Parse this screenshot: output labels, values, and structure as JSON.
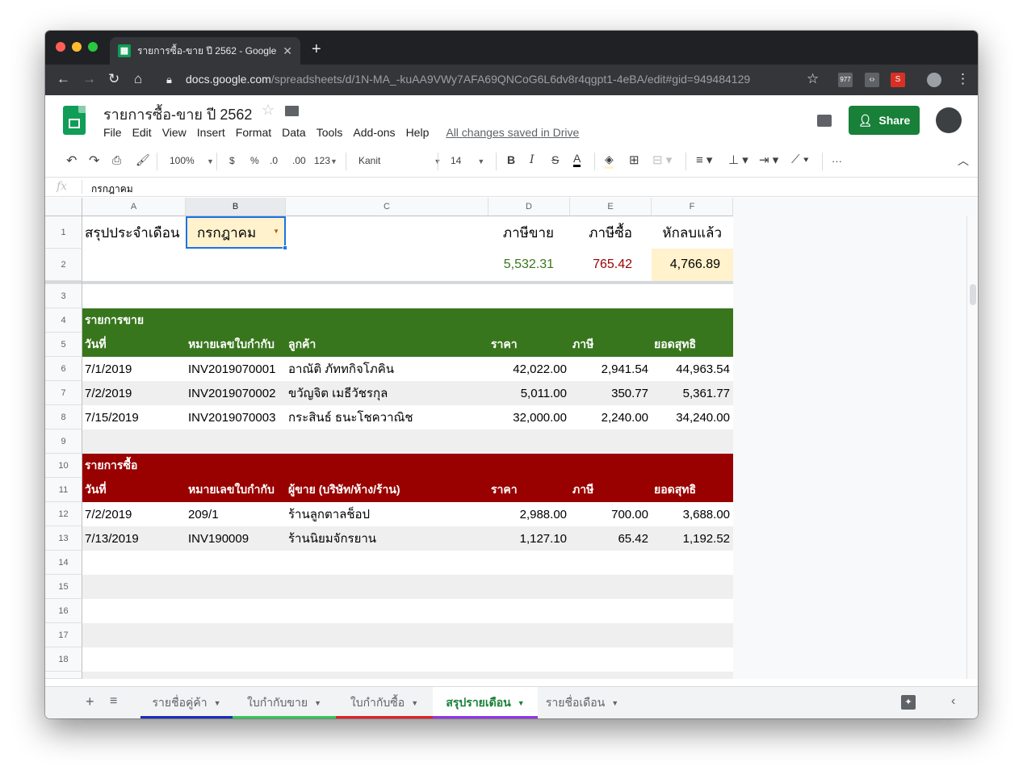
{
  "browser": {
    "tab_title": "รายการซื้อ-ขาย ปี 2562 - Google",
    "url_host": "docs.google.com",
    "url_path": "/spreadsheets/d/1N-MA_-kuAA9VWy7AFA69QNCoG6L6dv8r4qgpt1-4eBA/edit#gid=949484129",
    "ext_badge": "977"
  },
  "doc": {
    "title": "รายการซื้อ-ขาย ปี 2562",
    "menu": [
      "File",
      "Edit",
      "View",
      "Insert",
      "Format",
      "Data",
      "Tools",
      "Add-ons",
      "Help"
    ],
    "saved_status": "All changes saved in Drive",
    "share_label": "Share"
  },
  "toolbar": {
    "zoom": "100%",
    "currency": "$",
    "percent": "%",
    "dec_less": ".0",
    "dec_more": ".00",
    "more_formats": "123",
    "font": "Kanit",
    "font_size": "14",
    "bold": "B",
    "italic": "I",
    "strike": "S",
    "text_color": "A",
    "more": "···"
  },
  "formula_bar": {
    "fx": "fx",
    "value": "กรกฎาคม"
  },
  "columns": [
    "A",
    "B",
    "C",
    "D",
    "E",
    "F"
  ],
  "rows": [
    "1",
    "2",
    "3",
    "4",
    "5",
    "6",
    "7",
    "8",
    "9",
    "10",
    "11",
    "12",
    "13",
    "14",
    "15",
    "16",
    "17",
    "18"
  ],
  "summary": {
    "label": "สรุปประจำเดือน",
    "month": "กรกฎาคม",
    "h_sales_tax": "ภาษีขาย",
    "h_purchase_tax": "ภาษีซื้อ",
    "h_net": "หักลบแล้ว",
    "sales_tax": "5,532.31",
    "purchase_tax": "765.42",
    "net": "4,766.89"
  },
  "sales": {
    "title": "รายการขาย",
    "headers": [
      "วันที่",
      "หมายเลขใบกำกับ",
      "ลูกค้า",
      "ราคา",
      "ภาษี",
      "ยอดสุทธิ"
    ],
    "rows": [
      [
        "7/1/2019",
        "INV2019070001",
        "อาณัติ ภัททกิจโภคิน",
        "42,022.00",
        "2,941.54",
        "44,963.54"
      ],
      [
        "7/2/2019",
        "INV2019070002",
        "ขวัญจิต เมธีวัชรกุล",
        "5,011.00",
        "350.77",
        "5,361.77"
      ],
      [
        "7/15/2019",
        "INV2019070003",
        "กระสินธ์ ธนะโชควาณิช",
        "32,000.00",
        "2,240.00",
        "34,240.00"
      ]
    ]
  },
  "purchases": {
    "title": "รายการซื้อ",
    "headers": [
      "วันที่",
      "หมายเลขใบกำกับ",
      "ผู้ขาย (บริษัท/ห้าง/ร้าน)",
      "ราคา",
      "ภาษี",
      "ยอดสุทธิ"
    ],
    "rows": [
      [
        "7/2/2019",
        "209/1",
        "ร้านลูกตาลช็อป",
        "2,988.00",
        "700.00",
        "3,688.00"
      ],
      [
        "7/13/2019",
        "INV190009",
        "ร้านนิยมจักรยาน",
        "1,127.10",
        "65.42",
        "1,192.52"
      ]
    ]
  },
  "sheet_tabs": [
    "รายชื่อคู่ค้า",
    "ใบกำกับขาย",
    "ใบกำกับซื้อ",
    "สรุปรายเดือน",
    "รายชื่อเดือน"
  ],
  "colors": {
    "green_header": "#38761d",
    "red_header": "#990000",
    "sales_tax_text": "#38761d",
    "purchase_tax_text": "#990000",
    "highlight": "#fff2cc",
    "accent": "#188038"
  }
}
